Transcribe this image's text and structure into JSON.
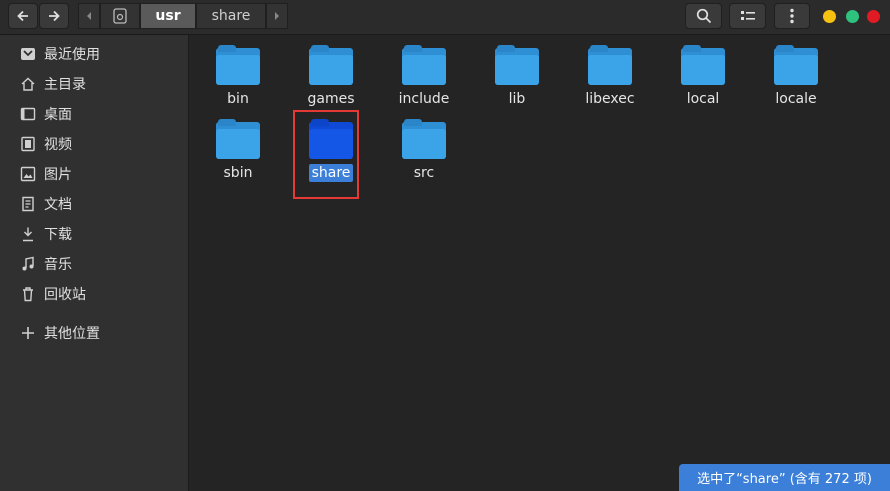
{
  "header": {
    "nav_back_icon": "arrow-left-icon",
    "nav_forward_icon": "arrow-right-icon",
    "breadcrumbs": [
      "usr",
      "share"
    ],
    "search_icon": "search-icon",
    "view_icon": "list-view-icon",
    "menu_icon": "menu-icon",
    "window_colors": {
      "minimize": "#f5c211",
      "maximize": "#2ec27e",
      "close": "#e01b24"
    }
  },
  "sidebar": {
    "items": [
      {
        "label": "最近使用",
        "icon": "recent-icon"
      },
      {
        "label": "主目录",
        "icon": "home-icon"
      },
      {
        "label": "桌面",
        "icon": "desktop-icon"
      },
      {
        "label": "视频",
        "icon": "video-icon"
      },
      {
        "label": "图片",
        "icon": "picture-icon"
      },
      {
        "label": "文档",
        "icon": "document-icon"
      },
      {
        "label": "下载",
        "icon": "download-icon"
      },
      {
        "label": "音乐",
        "icon": "music-icon"
      },
      {
        "label": "回收站",
        "icon": "trash-icon"
      },
      {
        "label": "其他位置",
        "icon": "plus-icon"
      }
    ]
  },
  "files": [
    {
      "name": "bin"
    },
    {
      "name": "games"
    },
    {
      "name": "include"
    },
    {
      "name": "lib"
    },
    {
      "name": "libexec"
    },
    {
      "name": "local"
    },
    {
      "name": "locale"
    },
    {
      "name": "sbin"
    },
    {
      "name": "share",
      "selected": true
    },
    {
      "name": "src"
    }
  ],
  "status": {
    "text": "选中了“share” (含有 272 项)"
  },
  "colors": {
    "accent": "#3b7fd9",
    "folder": "#3ba4e8",
    "selected_folder": "#1457e6",
    "highlight": "#e53935"
  }
}
